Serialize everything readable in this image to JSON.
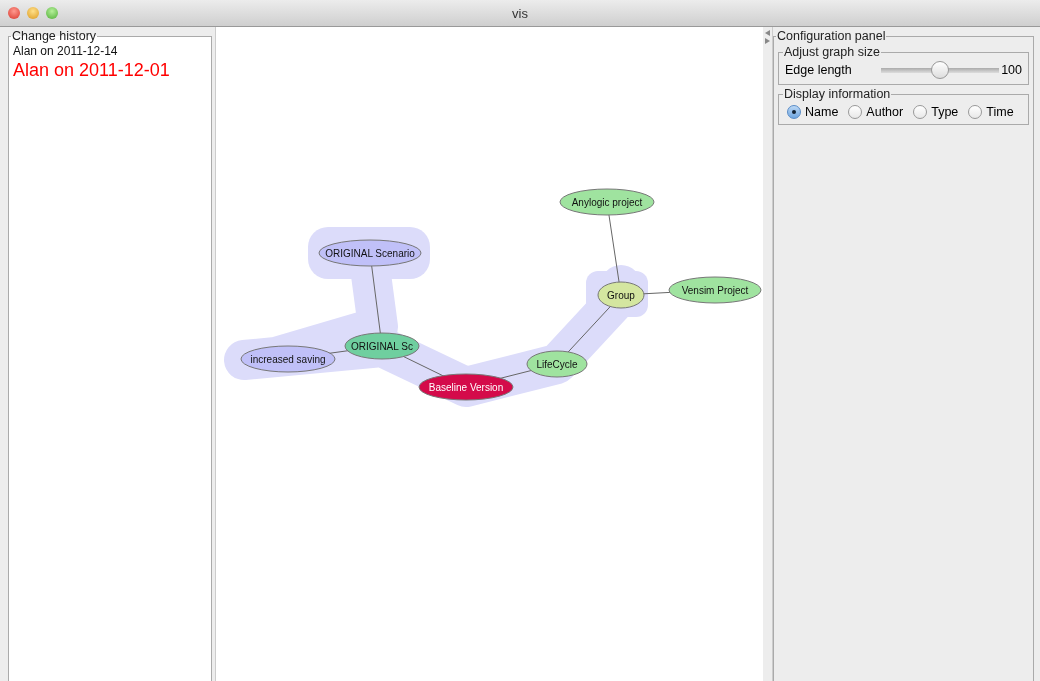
{
  "window": {
    "title": "vis"
  },
  "change_history": {
    "title": "Change history",
    "entries": [
      {
        "text": "Alan on 2011-12-14",
        "selected": false
      },
      {
        "text": "Alan on 2011-12-01",
        "selected": true
      }
    ]
  },
  "graph": {
    "nodes": [
      {
        "label": "Anylogic project",
        "color": "#9fe39f"
      },
      {
        "label": "ORIGINAL Scenario",
        "color": "#c0c0f8"
      },
      {
        "label": "Group",
        "color": "#d4e6a0"
      },
      {
        "label": "Vensim Project",
        "color": "#9fe39f"
      },
      {
        "label": "ORIGINAL Sc",
        "color": "#6fcf9f"
      },
      {
        "label": "increased saving",
        "color": "#c0c0f8"
      },
      {
        "label": "LifeCycle",
        "color": "#9fe39f"
      },
      {
        "label": "Baseline Version",
        "color": "#d40a4a"
      }
    ]
  },
  "configuration": {
    "title": "Configuration panel",
    "graph_size": {
      "title": "Adjust graph size",
      "label": "Edge length",
      "level": 0.5,
      "reading": "100"
    },
    "display": {
      "title": "Display information",
      "options": [
        {
          "label": "Name",
          "selected": true
        },
        {
          "label": "Author",
          "selected": false
        },
        {
          "label": "Type",
          "selected": false
        },
        {
          "label": "Time",
          "selected": false
        }
      ]
    }
  }
}
